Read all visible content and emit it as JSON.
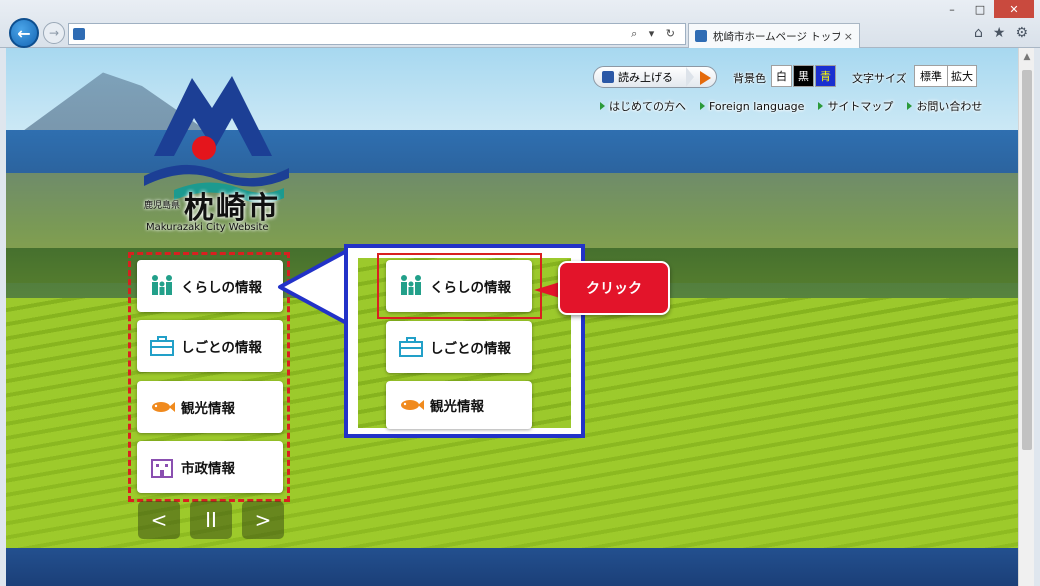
{
  "browser": {
    "tab_title": "枕崎市ホームページ トップページ",
    "tab_close": "×",
    "window_controls": [
      "–",
      "□",
      "✕"
    ],
    "address_icons": "⌕ ▾ ↻",
    "tool_icons": [
      "home-icon",
      "star-icon",
      "gear-icon"
    ]
  },
  "utility": {
    "readout_label": "読み上げる",
    "bg_color_label": "背景色",
    "bg_options": [
      {
        "label": "白",
        "bg": "#ffffff",
        "fg": "#111111"
      },
      {
        "label": "黒",
        "bg": "#000000",
        "fg": "#ffffff"
      },
      {
        "label": "青",
        "bg": "#1a2fd0",
        "fg": "#ffff00"
      }
    ],
    "font_size_label": "文字サイズ",
    "font_size_options": [
      "標準",
      "拡大"
    ]
  },
  "nav_links": [
    "はじめての方へ",
    "Foreign language",
    "サイトマップ",
    "お問い合わせ"
  ],
  "logo": {
    "prefecture": "鹿児島県",
    "city": "枕崎市",
    "english": "Makurazaki City Website"
  },
  "menu": [
    {
      "label": "くらしの情報",
      "icon": "family-icon"
    },
    {
      "label": "しごとの情報",
      "icon": "briefcase-icon"
    },
    {
      "label": "観光情報",
      "icon": "fish-icon"
    },
    {
      "label": "市政情報",
      "icon": "building-icon"
    }
  ],
  "zoom_menu": [
    {
      "label": "くらしの情報",
      "icon": "family-icon"
    },
    {
      "label": "しごとの情報",
      "icon": "briefcase-icon"
    },
    {
      "label": "観光情報",
      "icon": "fish-icon"
    }
  ],
  "slider_controls": [
    "<",
    "II",
    ">"
  ],
  "callout": "クリック",
  "colors": {
    "annotation_red": "#d92020",
    "zoom_border_blue": "#2232c8",
    "callout_red": "#e3142a",
    "icon_teal": "#22a08a",
    "icon_orange": "#f08a1e"
  }
}
